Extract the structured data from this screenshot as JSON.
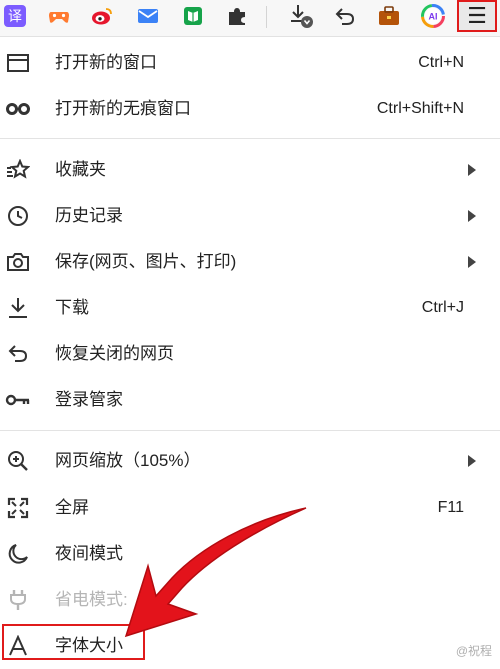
{
  "toolbar": {
    "translate_glyph": "译",
    "menu_glyph": "☰",
    "ai_glyph": "AI"
  },
  "menu": {
    "items": [
      {
        "label": "打开新的窗口",
        "shortcut": "Ctrl+N"
      },
      {
        "label": "打开新的无痕窗口",
        "shortcut": "Ctrl+Shift+N"
      },
      {
        "label": "收藏夹",
        "submenu": true
      },
      {
        "label": "历史记录",
        "submenu": true
      },
      {
        "label": "保存(网页、图片、打印)",
        "submenu": true
      },
      {
        "label": "下载",
        "shortcut": "Ctrl+J"
      },
      {
        "label": "恢复关闭的网页"
      },
      {
        "label": "登录管家"
      },
      {
        "label": "网页缩放（105%）",
        "submenu": true
      },
      {
        "label": "全屏",
        "shortcut": "F11"
      },
      {
        "label": "夜间模式"
      },
      {
        "label": "省电模式:",
        "disabled": true
      },
      {
        "label": "字体大小"
      }
    ]
  },
  "watermark": "@祝程",
  "colors": {
    "highlight": "#e01b1b",
    "translate": "#7c5cff",
    "game": "#ff7a2f",
    "weibo": "#e6162d",
    "mail": "#3b82f6",
    "book": "#16a34a",
    "bag": "#b45309"
  },
  "icons": [
    "translate-icon",
    "game-icon",
    "weibo-icon",
    "mail-icon",
    "book-icon",
    "extension-icon",
    "download-icon",
    "undo-icon",
    "briefcase-icon",
    "ai-icon",
    "menu-icon",
    "window-icon",
    "incognito-icon",
    "favorites-icon",
    "history-icon",
    "camera-icon",
    "download-icon",
    "restore-icon",
    "key-icon",
    "zoom-icon",
    "fullscreen-icon",
    "moon-icon",
    "plug-icon",
    "font-icon"
  ]
}
